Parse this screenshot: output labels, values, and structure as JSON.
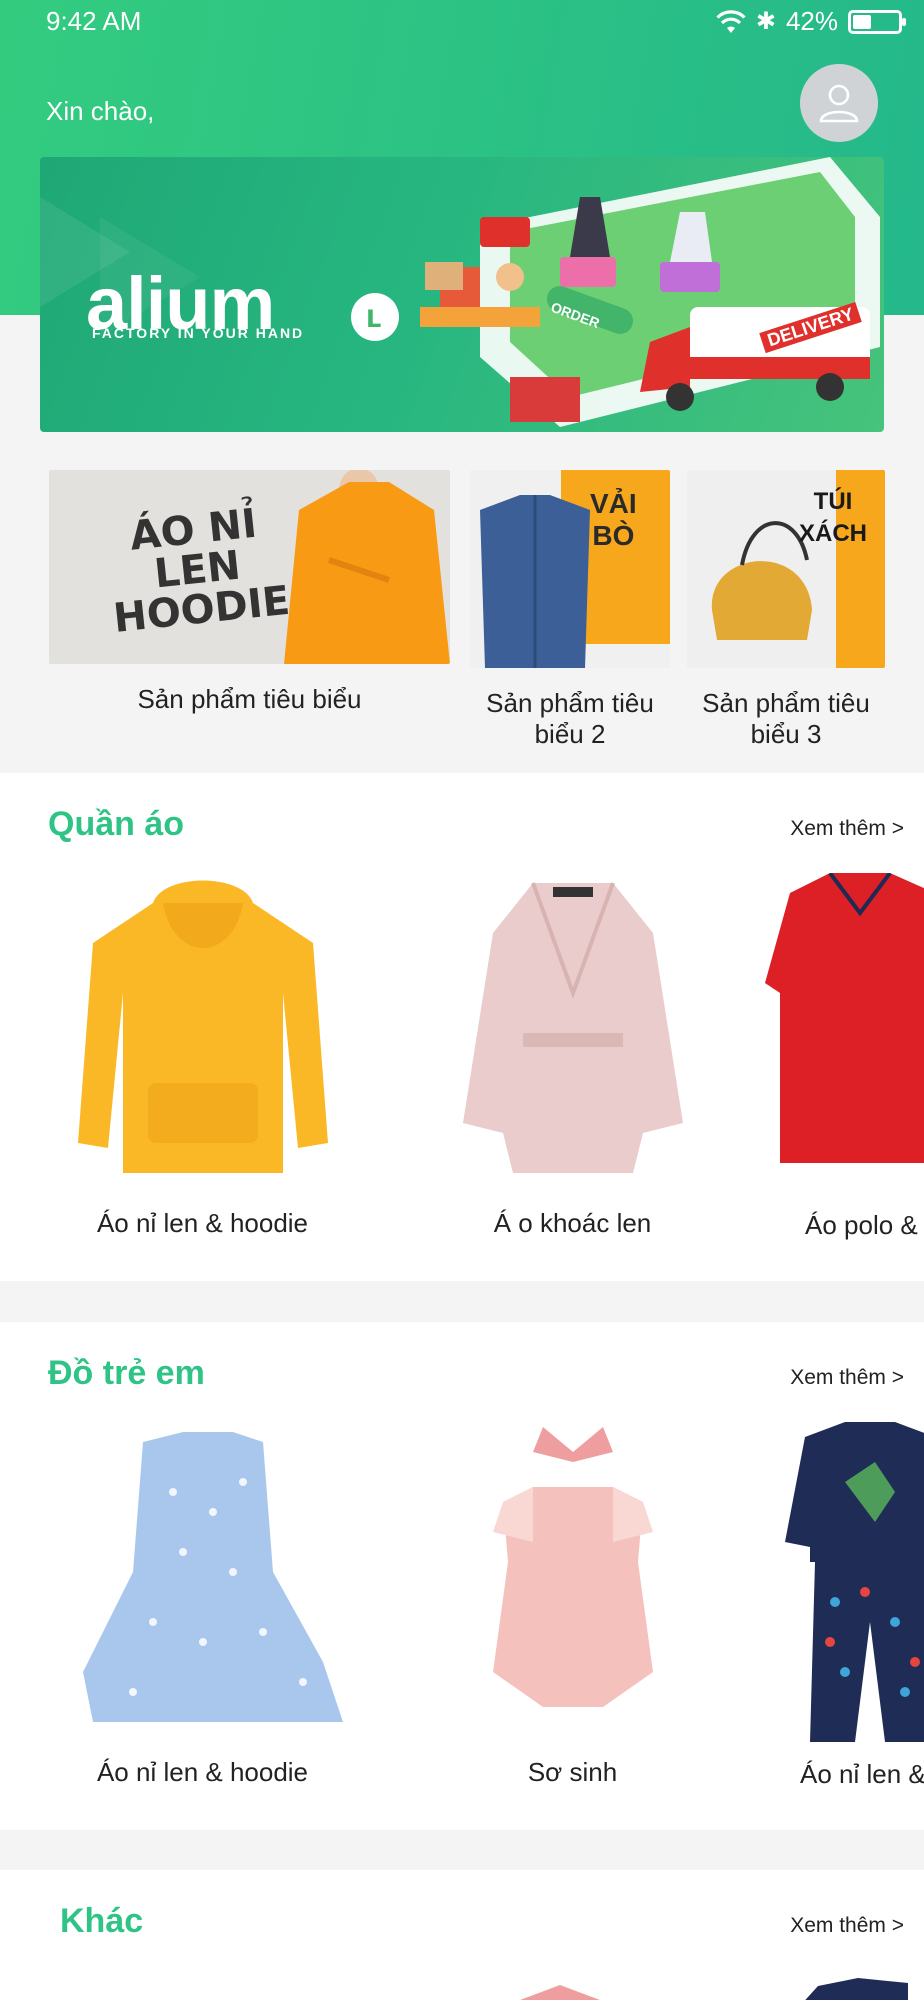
{
  "status_bar": {
    "time": "9:42 AM",
    "battery_text": "42%",
    "battery_level": 0.42
  },
  "header": {
    "greeting": "Xin chào,"
  },
  "banner": {
    "brand": "alium",
    "tagline": "FACTORY IN YOUR HAND",
    "badges": [
      "ORDER",
      "DELIVERY"
    ]
  },
  "featured": [
    {
      "title": "Sản phẩm tiêu biểu",
      "image_text": [
        "ÁO NỈ",
        "LEN",
        "HOODIE"
      ]
    },
    {
      "title": "Sản phẩm tiêu biểu 2",
      "image_text": [
        "VẢI",
        "BÒ"
      ]
    },
    {
      "title": "Sản phẩm tiêu biểu 3",
      "image_text": [
        "TÚI",
        "XÁCH"
      ]
    }
  ],
  "sections": [
    {
      "title": "Quần áo",
      "see_more": "Xem thêm >",
      "items": [
        {
          "label": "Áo nỉ len & hoodie",
          "icon": "hoodie-image"
        },
        {
          "label": "Á o khoác len",
          "icon": "coat-image"
        },
        {
          "label": "Áo polo &",
          "icon": "polo-image"
        }
      ]
    },
    {
      "title": "Đồ trẻ em",
      "see_more": "Xem thêm >",
      "items": [
        {
          "label": "Áo nỉ len & hoodie",
          "icon": "kids-dress-image"
        },
        {
          "label": "Sơ sinh",
          "icon": "romper-image"
        },
        {
          "label": "Áo nỉ len &",
          "icon": "kids-pajama-image"
        }
      ]
    },
    {
      "title": "Khác",
      "see_more": "Xem thêm >"
    }
  ],
  "colors": {
    "accent": "#2fc486",
    "header": "#2dc386",
    "section_bg": "#ffffff",
    "page_bg": "#f4f4f4"
  }
}
